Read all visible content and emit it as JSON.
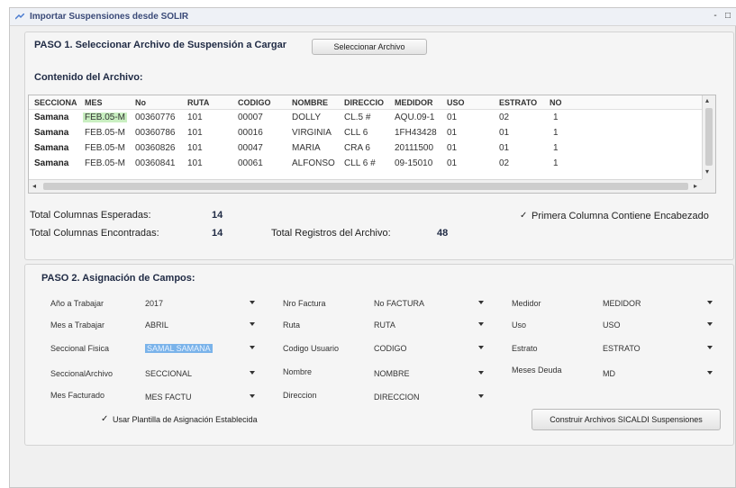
{
  "window": {
    "title": "Importar Suspensiones desde SOLIR",
    "controls": [
      "-",
      "□"
    ]
  },
  "paso1": {
    "title": "PASO 1. Seleccionar Archivo de Suspensión a Cargar",
    "select_button": "Seleccionar Archivo",
    "contenido_label": "Contenido del Archivo:"
  },
  "grid": {
    "columns": [
      "SECCIONA",
      "MES",
      "No",
      "RUTA",
      "CODIGO",
      "NOMBRE",
      "DIRECCIO",
      "MEDIDOR",
      "USO",
      "ESTRATO",
      "NO"
    ],
    "rows": [
      [
        "Samana",
        "FEB.05-M",
        "00360776",
        "101",
        "00007",
        "DOLLY",
        "CL.5 #",
        "AQU.09-1",
        "01",
        "02",
        "1"
      ],
      [
        "Samana",
        "FEB.05-M",
        "00360786",
        "101",
        "00016",
        "VIRGINIA",
        "CLL 6",
        "1FH43428",
        "01",
        "01",
        "1"
      ],
      [
        "Samana",
        "FEB.05-M",
        "00360826",
        "101",
        "00047",
        "MARIA",
        "CRA 6",
        "20111500",
        "01",
        "01",
        "1"
      ],
      [
        "Samana",
        "FEB.05-M",
        "00360841",
        "101",
        "00061",
        "ALFONSO",
        "CLL 6 #",
        "09-15010",
        "01",
        "02",
        "1"
      ]
    ],
    "h_left_arrow": "◂",
    "h_right_arrow": "▸",
    "v_up_arrow": "▴",
    "v_down_arrow": "▾"
  },
  "stats": {
    "esperadas_label": "Total Columnas Esperadas:",
    "esperadas_value": "14",
    "encontradas_label": "Total Columnas Encontradas:",
    "encontradas_value": "14",
    "registros_label": "Total Registros del Archivo:",
    "registros_value": "48",
    "encabezado_check": "✓",
    "encabezado_label": "Primera Columna Contiene Encabezado"
  },
  "paso2": {
    "title": "PASO 2. Asignación de Campos:",
    "fields": {
      "anio_label": "Año a Trabajar",
      "anio_value": "2017",
      "mes_label": "Mes a Trabajar",
      "mes_value": "ABRIL",
      "seccional_fisica_label": "Seccional Fisica",
      "seccional_fisica_value": "SAMAL SAMANA",
      "seccional_archivo_label": "SeccionalArchivo",
      "seccional_archivo_value": "SECCIONAL",
      "mes_facturado_label": "Mes Facturado",
      "mes_facturado_value": "MES FACTU",
      "nro_factura_label": "Nro Factura",
      "nro_factura_value": "No FACTURA",
      "ruta_label": "Ruta",
      "ruta_value": "RUTA",
      "codigo_usuario_label": "Codigo Usuario",
      "codigo_usuario_value": "CODIGO",
      "nombre_label": "Nombre",
      "nombre_value": "NOMBRE",
      "direccion_label": "Direccion",
      "direccion_value": "DIRECCION",
      "medidor_label": "Medidor",
      "medidor_value": "MEDIDOR",
      "uso_label": "Uso",
      "uso_value": "USO",
      "estrato_label": "Estrato",
      "estrato_value": "ESTRATO",
      "meses_deuda_label": "Meses Deuda",
      "meses_deuda_value": "MD"
    },
    "plantilla_check": "✓",
    "plantilla_label": "Usar Plantilla de Asignación Establecida",
    "construir_button": "Construir Archivos SICALDI Suspensiones"
  },
  "colors": {
    "title_text": "#3a4a78",
    "highlight_cell": "#c9efc1",
    "selection": "#7ab3ea"
  }
}
